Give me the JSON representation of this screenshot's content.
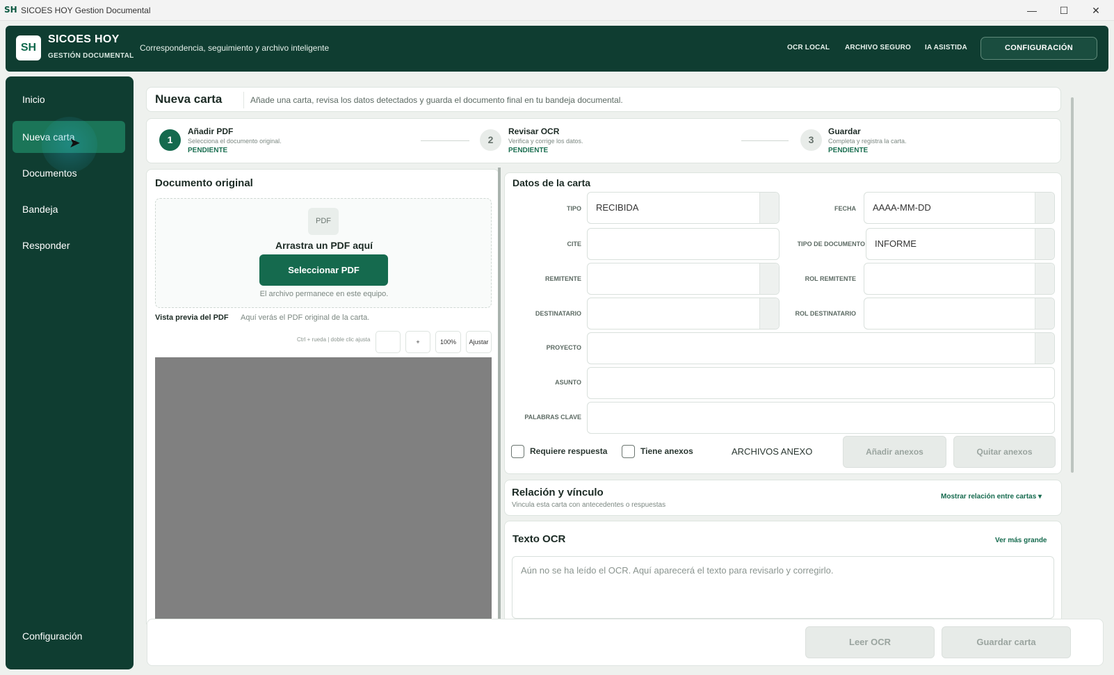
{
  "window": {
    "app_icon": "SH",
    "title": "SICOES HOY Gestion Documental",
    "minimize": "—",
    "maximize": "☐",
    "close": "✕"
  },
  "header": {
    "logo": "SH",
    "brand_name": "SICOES HOY",
    "brand_sub": "GESTIÓN DOCUMENTAL",
    "tagline": "Correspondencia, seguimiento y archivo inteligente",
    "nav": [
      "OCR LOCAL",
      "ARCHIVO SEGURO",
      "IA ASISTIDA"
    ],
    "config_button": "CONFIGURACIÓN"
  },
  "sidebar": {
    "items": [
      {
        "label": "Inicio"
      },
      {
        "label": "Nueva carta",
        "active": true
      },
      {
        "label": "Documentos"
      },
      {
        "label": "Bandeja"
      },
      {
        "label": "Responder"
      }
    ],
    "bottom": "Configuración"
  },
  "page": {
    "title": "Nueva carta",
    "description": "Añade una carta, revisa los datos detectados y guarda el documento final en tu bandeja documental."
  },
  "steps": [
    {
      "number": "1",
      "title": "Añadir PDF",
      "desc": "Selecciona el documento original.",
      "status": "PENDIENTE"
    },
    {
      "number": "2",
      "title": "Revisar OCR",
      "desc": "Verifica y corrige los datos.",
      "status": "PENDIENTE"
    },
    {
      "number": "3",
      "title": "Guardar",
      "desc": "Completa y registra la carta.",
      "status": "PENDIENTE"
    }
  ],
  "original": {
    "title": "Documento original",
    "pdf_icon": "PDF",
    "drop_text": "Arrastra un PDF aquí",
    "select_button": "Seleccionar PDF",
    "hint": "El archivo permanece en este equipo.",
    "preview_label": "Vista previa del PDF",
    "preview_desc": "Aquí verás el PDF original de la carta.",
    "zoom_hint": "Ctrl + rueda | doble clic ajusta",
    "zoom_minus": "",
    "zoom_plus": "+",
    "zoom_level": "100%",
    "fit_button": "Ajustar"
  },
  "form": {
    "title": "Datos de la carta",
    "tipo_label": "TIPO",
    "tipo_value": "RECIBIDA",
    "fecha_label": "FECHA",
    "fecha_placeholder": "AAAA-MM-DD",
    "cite_label": "CITE",
    "cite_value": "",
    "tipo_doc_label": "TIPO DE DOCUMENTO",
    "tipo_doc_value": "INFORME",
    "remitente_label": "REMITENTE",
    "rol_remitente_label": "ROL REMITENTE",
    "destinatario_label": "DESTINATARIO",
    "rol_destinatario_label": "ROL DESTINATARIO",
    "proyecto_label": "PROYECTO",
    "asunto_label": "ASUNTO",
    "palabras_label": "PALABRAS CLAVE",
    "requiere_respuesta": "Requiere respuesta",
    "tiene_anexos": "Tiene anexos",
    "archivos_anexo": "ARCHIVOS ANEXO",
    "add_anexos": "Añadir anexos",
    "remove_anexos": "Quitar anexos"
  },
  "relation": {
    "title": "Relación y vínculo",
    "desc": "Vincula esta carta con antecedentes o respuestas",
    "link": "Mostrar relación entre cartas ▾"
  },
  "ocr": {
    "title": "Texto OCR",
    "link": "Ver más grande",
    "placeholder": "Aún no se ha leído el OCR. Aquí aparecerá el texto para revisarlo y corregirlo."
  },
  "footer": {
    "read_ocr": "Leer OCR",
    "save": "Guardar carta"
  }
}
